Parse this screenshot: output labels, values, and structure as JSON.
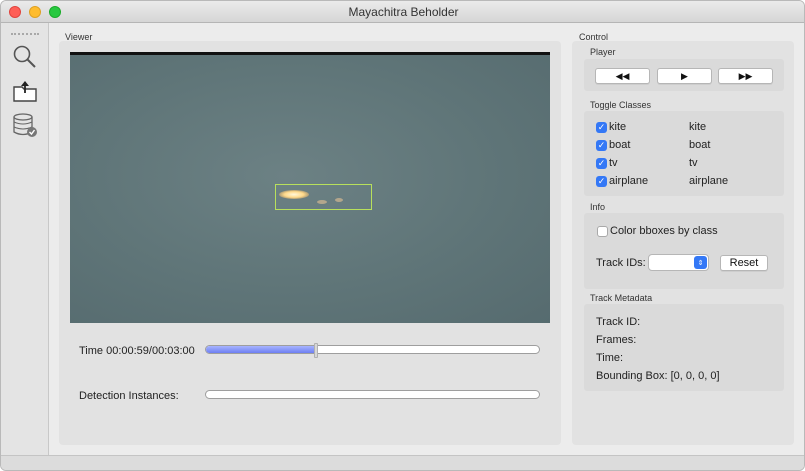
{
  "window": {
    "title": "Mayachitra Beholder"
  },
  "toolbar": {
    "icons": [
      "search-icon",
      "open-folder-icon",
      "database-settings-icon"
    ]
  },
  "viewer": {
    "section_label": "Viewer",
    "time_label": "Time 00:00:59/00:03:00",
    "time_progress": 0.33,
    "detection_label": "Detection Instances:",
    "detection_progress": 0.0
  },
  "control": {
    "section_label": "Control",
    "player": {
      "label": "Player",
      "rewind_glyph": "◀◀",
      "play_glyph": "▶",
      "forward_glyph": "▶▶"
    },
    "toggle_classes": {
      "label": "Toggle Classes",
      "items": [
        {
          "label": "kite",
          "value": "kite",
          "checked": true
        },
        {
          "label": "boat",
          "value": "boat",
          "checked": true
        },
        {
          "label": "tv",
          "value": "tv",
          "checked": true
        },
        {
          "label": "airplane",
          "value": "airplane",
          "checked": true
        }
      ]
    },
    "info": {
      "label": "Info",
      "color_bboxes_label": "Color bboxes by class",
      "color_bboxes_checked": false,
      "track_ids_label": "Track IDs:",
      "track_ids_value": "",
      "reset_label": "Reset"
    },
    "track_metadata": {
      "label": "Track Metadata",
      "track_id_label": "Track ID:",
      "frames_label": "Frames:",
      "time_label": "Time:",
      "bounding_box_label": "Bounding Box: [0, 0, 0, 0]"
    }
  },
  "colors": {
    "accent": "#3478f6",
    "bbox": "#b8e05c",
    "progress": "#7b8cf5"
  }
}
